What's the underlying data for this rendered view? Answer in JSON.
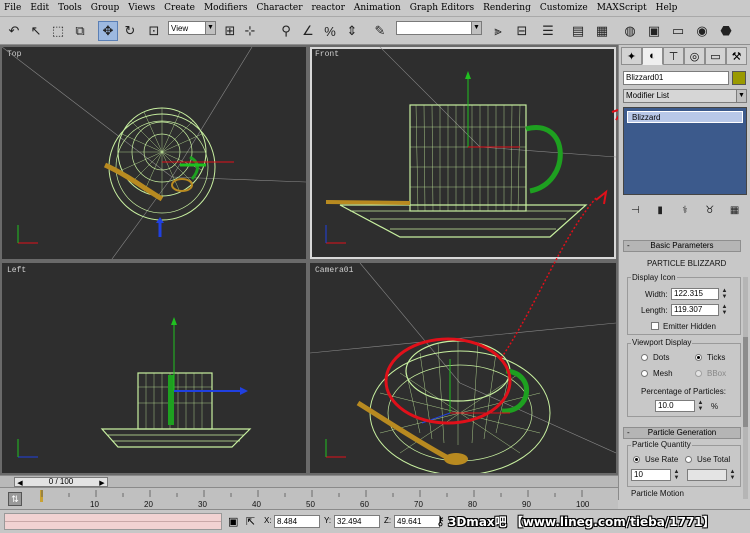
{
  "menu": [
    "File",
    "Edit",
    "Tools",
    "Group",
    "Views",
    "Create",
    "Modifiers",
    "Character",
    "reactor",
    "Animation",
    "Graph Editors",
    "Rendering",
    "Customize",
    "MAXScript",
    "Help"
  ],
  "toolbar": {
    "ref_coord": "View",
    "named_sel": ""
  },
  "viewports": {
    "top": "Top",
    "front": "Front",
    "left": "Left",
    "camera": "Camera01"
  },
  "command_panel": {
    "object_name": "Blizzard01",
    "modifier_list": "Modifier List",
    "stack_item": "Blizzard",
    "basic_params": {
      "header": "Basic Parameters",
      "title": "PARTICLE BLIZZARD",
      "display_icon": "Display Icon",
      "width_label": "Width:",
      "width_value": "122.315",
      "length_label": "Length:",
      "length_value": "119.307",
      "emitter_hidden": "Emitter Hidden",
      "viewport_display": "Viewport Display",
      "dots": "Dots",
      "ticks": "Ticks",
      "mesh": "Mesh",
      "bbox": "BBox",
      "pct_label": "Percentage of Particles:",
      "pct_value": "10.0",
      "pct_unit": "%"
    },
    "particle_gen": {
      "header": "Particle Generation",
      "quantity": "Particle Quantity",
      "use_rate": "Use Rate",
      "use_total": "Use Total",
      "rate_value": "10",
      "total_value": "",
      "motion": "Particle Motion"
    }
  },
  "timeline": {
    "frame": "0 / 100",
    "ticks": [
      "10",
      "20",
      "30",
      "40",
      "50",
      "60",
      "70",
      "80",
      "90",
      "100"
    ]
  },
  "status": {
    "x_label": "X:",
    "x_value": "8.484",
    "y_label": "Y:",
    "y_value": "32.494",
    "z_label": "Z:",
    "z_value": "49.641",
    "watermark": "3Dmax吧 【www.lineg.com/tieba/1771】"
  },
  "colors": {
    "viewport_bg": "#2e2e2e",
    "wire_green": "#c8f0a0",
    "annotation_red": "#e0101a",
    "spoon": "#b88a20",
    "stack_bg": "#3c5a8c"
  }
}
